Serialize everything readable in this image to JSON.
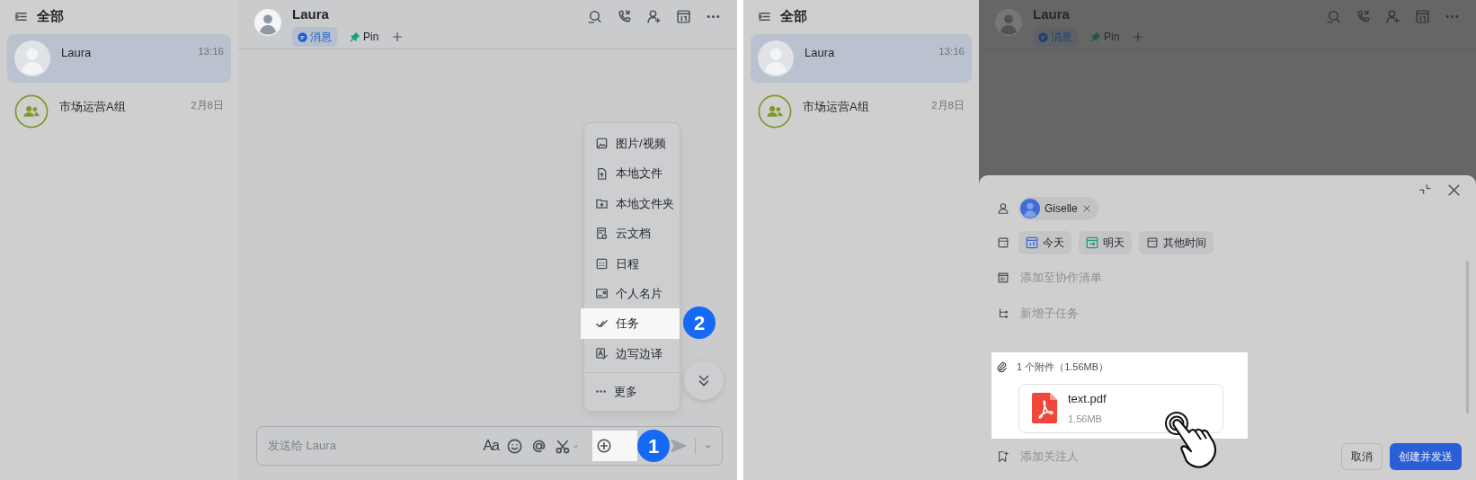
{
  "left_screen": {
    "sidebar": {
      "title": "全部",
      "chats": [
        {
          "name": "Laura",
          "time": "13:16",
          "kind": "person",
          "selected": true
        },
        {
          "name": "市场运营A组",
          "time": "2月8日",
          "kind": "group",
          "selected": false
        }
      ]
    },
    "header": {
      "title": "Laura",
      "dimmed": false,
      "tabs": [
        {
          "label": "消息",
          "kind": "message",
          "selected": true
        },
        {
          "label": "Pin",
          "kind": "pin",
          "selected": false
        }
      ]
    },
    "attach_menu": {
      "items": [
        {
          "label": "图片/视频",
          "kind": "image",
          "highlighted": false
        },
        {
          "label": "本地文件",
          "kind": "file",
          "highlighted": false
        },
        {
          "label": "本地文件夹",
          "kind": "folder",
          "highlighted": false
        },
        {
          "label": "云文档",
          "kind": "doc",
          "highlighted": false
        },
        {
          "label": "日程",
          "kind": "calendar",
          "highlighted": false
        },
        {
          "label": "个人名片",
          "kind": "card",
          "highlighted": false
        },
        {
          "label": "任务",
          "kind": "task",
          "highlighted": true,
          "step": "2"
        },
        {
          "label": "边写边译",
          "kind": "translate",
          "highlighted": false
        }
      ],
      "more": "更多"
    },
    "composer": {
      "placeholder": "发送给 Laura",
      "format_label": "Aa",
      "plus_highlighted": true,
      "step": "1"
    }
  },
  "right_screen": {
    "sidebar": {
      "title": "全部",
      "chats": [
        {
          "name": "Laura",
          "time": "13:16",
          "kind": "person",
          "selected": true
        },
        {
          "name": "市场运营A组",
          "time": "2月8日",
          "kind": "group",
          "selected": false
        }
      ]
    },
    "header": {
      "title": "Laura",
      "dimmed": true,
      "tabs": [
        {
          "label": "消息",
          "kind": "message",
          "selected": true
        },
        {
          "label": "Pin",
          "kind": "pin",
          "selected": false
        }
      ]
    },
    "task_dialog": {
      "assignee": "Giselle",
      "dates": [
        {
          "label": "今天",
          "kind": "today"
        },
        {
          "label": "明天",
          "kind": "tomorrow"
        },
        {
          "label": "其他时间",
          "kind": "other"
        }
      ],
      "list": {
        "placeholder": "添加至协作清单"
      },
      "subtask": {
        "placeholder": "新增子任务"
      },
      "attachments": {
        "title": "1 个附件（1.56MB）",
        "highlighted": true,
        "files": [
          {
            "name": "text.pdf",
            "size": "1.56MB"
          }
        ]
      },
      "follower": {
        "placeholder": "添加关注人"
      },
      "buttons": [
        {
          "label": "取消",
          "kind": "secondary"
        },
        {
          "label": "创建并发送",
          "kind": "primary"
        }
      ]
    }
  }
}
